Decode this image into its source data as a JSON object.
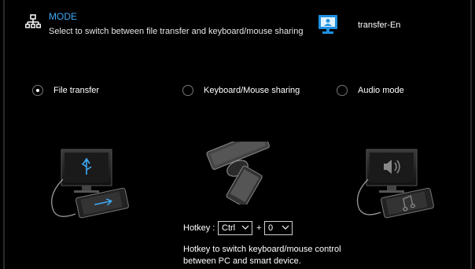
{
  "header": {
    "title": "MODE",
    "description": "Select to switch between file transfer and keyboard/mouse sharing"
  },
  "device": {
    "name": "transfer-En"
  },
  "options": [
    {
      "label": "File transfer",
      "selected": true
    },
    {
      "label": "Keyboard/Mouse sharing",
      "selected": false
    },
    {
      "label": "Audio mode",
      "selected": false
    }
  ],
  "hotkey": {
    "label": "Hotkey :",
    "modifier": "Ctrl",
    "plus": "+",
    "key": "0",
    "help": "Hotkey to switch keyboard/mouse control between PC and smart device."
  },
  "colors": {
    "accent": "#3fa9f5",
    "background": "#000000"
  }
}
